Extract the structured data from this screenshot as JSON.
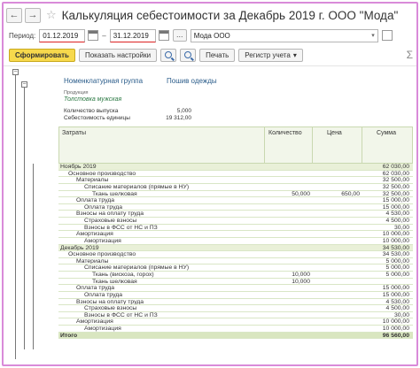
{
  "window": {
    "title": "Калькуляция себестоимости за Декабрь 2019 г. ООО \"Мода\"",
    "back_glyph": "←",
    "forward_glyph": "→",
    "favorite_glyph": "☆"
  },
  "filters": {
    "period_label": "Период:",
    "date_from": "01.12.2019",
    "date_to": "31.12.2019",
    "range_dash": "–",
    "dots_label": "...",
    "organization": "Мода ООО",
    "dropdown_glyph": "▾"
  },
  "toolbar": {
    "generate_label": "Сформировать",
    "settings_label": "Показать настройки",
    "print_label": "Печать",
    "register_label": "Регистр учета",
    "register_caret": "▾",
    "sigma": "Σ"
  },
  "report": {
    "group_header_label": "Номенклатурная группа",
    "group_header_value": "Пошив одежды",
    "product_caption": "Продукция",
    "product_name": "Толстовка мужская",
    "output_qty_label": "Количество выпуска",
    "output_qty_value": "5,000",
    "unit_cost_label": "Себестоимость единицы",
    "unit_cost_value": "19 312,00",
    "columns": {
      "costs": "Затраты",
      "quantity": "Количество",
      "price": "Цена",
      "sum": "Сумма"
    },
    "rows": [
      {
        "name": "Ноябрь 2019",
        "qty": "",
        "price": "",
        "sum": "62 030,00",
        "indent": 0,
        "group": true,
        "underline": true
      },
      {
        "name": "Основное производство",
        "qty": "",
        "price": "",
        "sum": "62 030,00",
        "indent": 1
      },
      {
        "name": "Материалы",
        "qty": "",
        "price": "",
        "sum": "32 500,00",
        "indent": 2
      },
      {
        "name": "Списание материалов (прямые в НУ)",
        "qty": "",
        "price": "",
        "sum": "32 500,00",
        "indent": 3
      },
      {
        "name": "Ткань шелковая",
        "qty": "50,000",
        "price": "650,00",
        "sum": "32 500,00",
        "indent": 4
      },
      {
        "name": "Оплата труда",
        "qty": "",
        "price": "",
        "sum": "15 000,00",
        "indent": 2
      },
      {
        "name": "Оплата труда",
        "qty": "",
        "price": "",
        "sum": "15 000,00",
        "indent": 3
      },
      {
        "name": "Взносы на оплату труда",
        "qty": "",
        "price": "",
        "sum": "4 530,00",
        "indent": 2
      },
      {
        "name": "Страховые взносы",
        "qty": "",
        "price": "",
        "sum": "4 500,00",
        "indent": 3
      },
      {
        "name": "Взносы в ФСС от НС и ПЗ",
        "qty": "",
        "price": "",
        "sum": "30,00",
        "indent": 3
      },
      {
        "name": "Амортизация",
        "qty": "",
        "price": "",
        "sum": "10 000,00",
        "indent": 2
      },
      {
        "name": "Амортизация",
        "qty": "",
        "price": "",
        "sum": "10 000,00",
        "indent": 3
      },
      {
        "name": "Декабрь 2019",
        "qty": "",
        "price": "",
        "sum": "34 530,00",
        "indent": 0,
        "group": true
      },
      {
        "name": "Основное производство",
        "qty": "",
        "price": "",
        "sum": "34 530,00",
        "indent": 1
      },
      {
        "name": "Материалы",
        "qty": "",
        "price": "",
        "sum": "5 000,00",
        "indent": 2
      },
      {
        "name": "Списание материалов (прямые в НУ)",
        "qty": "",
        "price": "",
        "sum": "5 000,00",
        "indent": 3
      },
      {
        "name": "Ткань (вискоза, горох)",
        "qty": "10,000",
        "price": "",
        "sum": "5 000,00",
        "indent": 4
      },
      {
        "name": "Ткань шелковая",
        "qty": "10,000",
        "price": "",
        "sum": "",
        "indent": 4
      },
      {
        "name": "Оплата труда",
        "qty": "",
        "price": "",
        "sum": "15 000,00",
        "indent": 2
      },
      {
        "name": "Оплата труда",
        "qty": "",
        "price": "",
        "sum": "15 000,00",
        "indent": 3
      },
      {
        "name": "Взносы на оплату труда",
        "qty": "",
        "price": "",
        "sum": "4 530,00",
        "indent": 2
      },
      {
        "name": "Страховые взносы",
        "qty": "",
        "price": "",
        "sum": "4 500,00",
        "indent": 3
      },
      {
        "name": "Взносы в ФСС от НС и ПЗ",
        "qty": "",
        "price": "",
        "sum": "30,00",
        "indent": 3
      },
      {
        "name": "Амортизация",
        "qty": "",
        "price": "",
        "sum": "10 000,00",
        "indent": 2
      },
      {
        "name": "Амортизация",
        "qty": "",
        "price": "",
        "sum": "10 000,00",
        "indent": 3
      },
      {
        "name": "Итого",
        "qty": "",
        "price": "",
        "sum": "96 560,00",
        "indent": 0,
        "total": true,
        "underline": true
      }
    ]
  }
}
